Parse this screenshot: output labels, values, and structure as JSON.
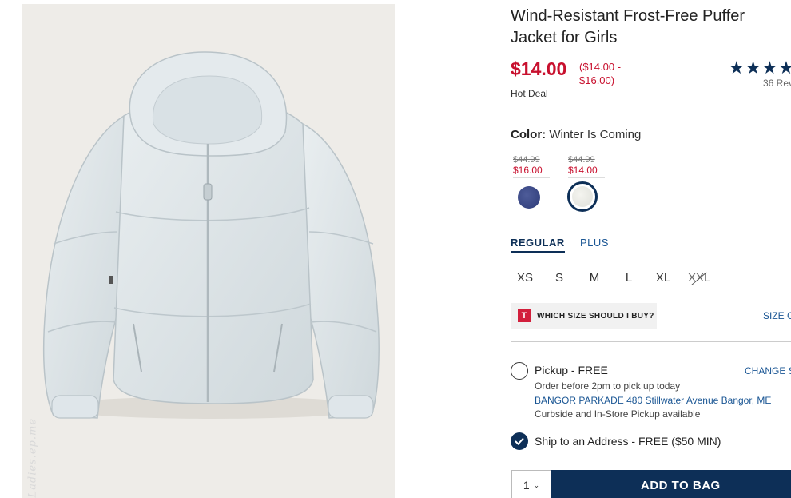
{
  "product": {
    "title": "Wind-Resistant Frost-Free Puffer Jacket for Girls",
    "image_alt": "light gray hooded puffer jacket",
    "watermark_text": "Ladies.ep.me"
  },
  "pricing": {
    "current": "$14.00",
    "range": "($14.00 - $16.00)",
    "badge": "Hot Deal"
  },
  "rating": {
    "stars": "★★★★",
    "review_count": "36 Rev"
  },
  "color": {
    "label": "Color:",
    "selected": "Winter Is Coming",
    "swatches": [
      {
        "name": "navy",
        "was": "$44.99",
        "now": "$16.00",
        "color": "#34417e"
      },
      {
        "name": "winter-is-coming",
        "was": "$44.99",
        "now": "$14.00",
        "color": "#e6e7e1"
      }
    ]
  },
  "fit": {
    "tabs": [
      "REGULAR",
      "PLUS"
    ],
    "selected": "REGULAR"
  },
  "sizes": [
    {
      "label": "XS",
      "available": true
    },
    {
      "label": "S",
      "available": true
    },
    {
      "label": "M",
      "available": true
    },
    {
      "label": "L",
      "available": true
    },
    {
      "label": "XL",
      "available": true
    },
    {
      "label": "XXL",
      "available": false
    }
  ],
  "size_help": {
    "logo": "T",
    "label": "WHICH SIZE SHOULD I BUY?",
    "guide_link": "SIZE G"
  },
  "fulfillment": {
    "pickup": {
      "label": "Pickup - FREE",
      "change_store": "CHANGE ST",
      "note": "Order before 2pm to pick up today",
      "store": "BANGOR PARKADE 480 Stillwater Avenue  Bangor, ME",
      "availability": "Curbside and In-Store Pickup available",
      "selected": false
    },
    "ship": {
      "label": "Ship to an Address - FREE ($50 MIN)",
      "selected": true
    }
  },
  "cart": {
    "quantity": "1",
    "add_label": "ADD TO BAG"
  },
  "colors": {
    "brand_navy": "#0d2f57",
    "sale_red": "#c8102e",
    "link_blue": "#1a5694"
  }
}
